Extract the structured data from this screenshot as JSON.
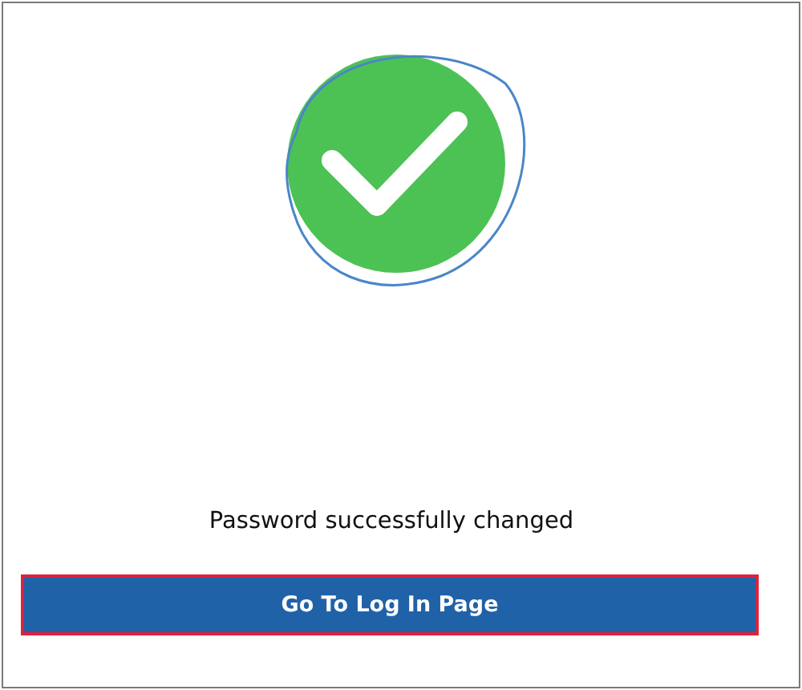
{
  "message": "Password successfully changed",
  "button": {
    "label": "Go To Log In Page",
    "focused": true
  }
}
